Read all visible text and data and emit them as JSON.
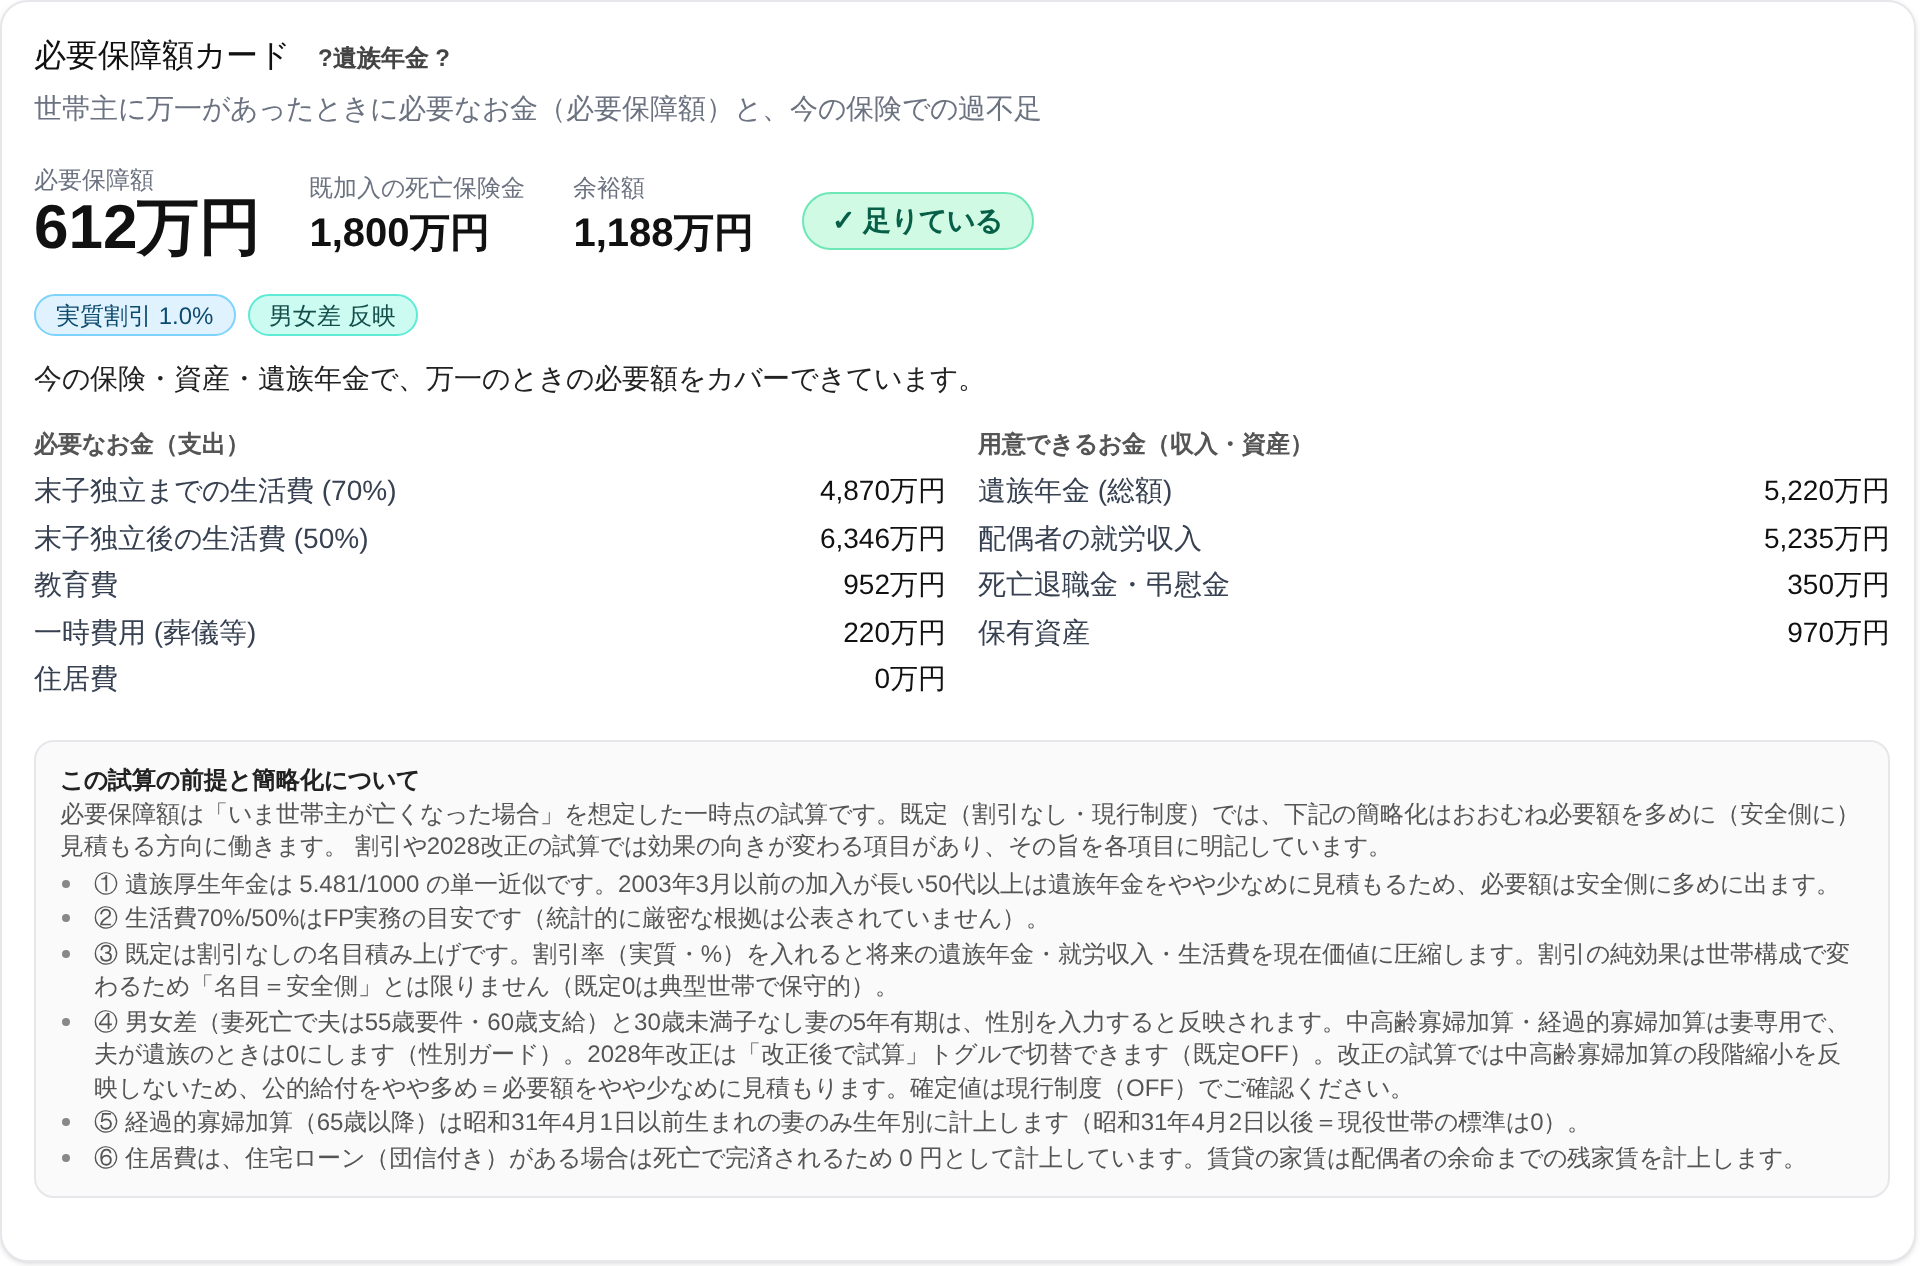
{
  "card": {
    "title": "必要保障額カード",
    "help_link": "?遺族年金 ?",
    "subtitle": "世帯主に万一があったときに必要なお金（必要保障額）と、今の保険での過不足"
  },
  "metrics": [
    {
      "kind": "primary",
      "label": "必要保障額",
      "value": "612万円"
    },
    {
      "kind": "secondary",
      "label": "既加入の死亡保険金",
      "value": "1,800万円"
    },
    {
      "kind": "secondary",
      "label": "余裕額",
      "value": "1,188万円"
    }
  ],
  "status_badge": {
    "kind": "ok",
    "label": "✓ 足りている"
  },
  "tags": [
    {
      "kind": "info",
      "label": "実質割引 1.0%"
    },
    {
      "kind": "accent",
      "label": "男女差 反映"
    }
  ],
  "summary": "今の保険・資産・遺族年金で、万一のときの必要額をカバーできています。",
  "expenses": {
    "heading": "必要なお金（支出）",
    "rows": [
      {
        "label": "末子独立までの生活費 (70%)",
        "value": "4,870万円"
      },
      {
        "label": "末子独立後の生活費 (50%)",
        "value": "6,346万円"
      },
      {
        "label": "教育費",
        "value": "952万円"
      },
      {
        "label": "一時費用 (葬儀等)",
        "value": "220万円"
      },
      {
        "label": "住居費",
        "value": "0万円"
      }
    ]
  },
  "resources": {
    "heading": "用意できるお金（収入・資産）",
    "rows": [
      {
        "label": "遺族年金 (総額)",
        "value": "5,220万円"
      },
      {
        "label": "配偶者の就労収入",
        "value": "5,235万円"
      },
      {
        "label": "死亡退職金・弔慰金",
        "value": "350万円"
      },
      {
        "label": "保有資産",
        "value": "970万円"
      }
    ]
  },
  "notes": {
    "title": "この試算の前提と簡略化について",
    "intro": "必要保障額は「いま世帯主が亡くなった場合」を想定した一時点の試算です。既定（割引なし・現行制度）では、下記の簡略化はおおむね必要額を多めに（安全側に）見積もる方向に働きます。 割引や2028改正の試算では効果の向きが変わる項目があり、その旨を各項目に明記しています。",
    "items": [
      "① 遺族厚生年金は 5.481/1000 の単一近似です。2003年3月以前の加入が長い50代以上は遺族年金をやや少なめに見積もるため、必要額は安全側に多めに出ます。",
      "② 生活費70%/50%はFP実務の目安です（統計的に厳密な根拠は公表されていません）。",
      "③ 既定は割引なしの名目積み上げです。割引率（実質・%）を入れると将来の遺族年金・就労収入・生活費を現在価値に圧縮します。割引の純効果は世帯構成で変わるため「名目＝安全側」とは限りません（既定0は典型世帯で保守的）。",
      "④ 男女差（妻死亡で夫は55歳要件・60歳支給）と30歳未満子なし妻の5年有期は、性別を入力すると反映されます。中高齢寡婦加算・経過的寡婦加算は妻専用で、夫が遺族のときは0にします（性別ガード）。2028年改正は「改正後で試算」トグルで切替できます（既定OFF）。改正の試算では中高齢寡婦加算の段階縮小を反映しないため、公的給付をやや多め＝必要額をやや少なめに見積もります。確定値は現行制度（OFF）でご確認ください。",
      "⑤ 経過的寡婦加算（65歳以降）は昭和31年4月1日以前生まれの妻のみ生年別に計上します（昭和31年4月2日以後＝現役世帯の標準は0）。",
      "⑥ 住居費は、住宅ローン（団信付き）がある場合は死亡で完済されるため 0 円として計上しています。賃貸の家賃は配偶者の余命までの残家賃を計上します。"
    ]
  }
}
